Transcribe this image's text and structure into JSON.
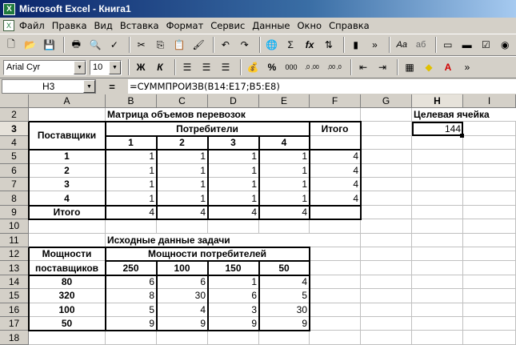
{
  "window": {
    "title": "Microsoft Excel - Книга1",
    "logo": "X"
  },
  "menu": [
    "Файл",
    "Правка",
    "Вид",
    "Вставка",
    "Формат",
    "Сервис",
    "Данные",
    "Окно",
    "Справка"
  ],
  "toolbar": {
    "font": "Arial Cyr",
    "size": "10",
    "bold": "Ж",
    "italic": "К",
    "percent": "%",
    "thousands": "000",
    "inc_dec": ",0 ,00",
    "dec_dec": ",00 ,0",
    "sigma": "Σ",
    "fx": "fx",
    "aa": "Аа",
    "ab": "аб"
  },
  "formula_bar": {
    "cell_ref": "H3",
    "equals": "=",
    "formula": "=СУММПРОИЗВ(B14:E17;B5:E8)"
  },
  "columns": [
    "A",
    "B",
    "C",
    "D",
    "E",
    "F",
    "G",
    "H",
    "I"
  ],
  "rows": [
    "2",
    "3",
    "4",
    "5",
    "6",
    "7",
    "8",
    "9",
    "10",
    "11",
    "12",
    "13",
    "14",
    "15",
    "16",
    "17",
    "18"
  ],
  "active": {
    "col": "H",
    "row": "3"
  },
  "sheet": {
    "matrix_title": "Матрица объемов перевозок",
    "suppliers": "Поставщики",
    "consumers": "Потребители",
    "total": "Итого",
    "target_label": "Целевая ячейка",
    "target_value": "144",
    "consumer_nums": [
      "1",
      "2",
      "3",
      "4"
    ],
    "supplier_nums": [
      "1",
      "2",
      "3",
      "4"
    ],
    "matrix": [
      [
        "1",
        "1",
        "1",
        "1"
      ],
      [
        "1",
        "1",
        "1",
        "1"
      ],
      [
        "1",
        "1",
        "1",
        "1"
      ],
      [
        "1",
        "1",
        "1",
        "1"
      ]
    ],
    "row_totals": [
      "4",
      "4",
      "4",
      "4"
    ],
    "total_label": "Итого",
    "col_totals": [
      "4",
      "4",
      "4",
      "4"
    ],
    "source_title": "Исходные данные задачи",
    "supplier_power_1": "Мощности",
    "supplier_power_2": "поставщиков",
    "consumer_power": "Мощности потребителей",
    "consumer_caps": [
      "250",
      "100",
      "150",
      "50"
    ],
    "supplier_caps": [
      "80",
      "320",
      "100",
      "50"
    ],
    "costs": [
      [
        "6",
        "6",
        "1",
        "4"
      ],
      [
        "8",
        "30",
        "6",
        "5"
      ],
      [
        "5",
        "4",
        "3",
        "30"
      ],
      [
        "9",
        "9",
        "9",
        "9"
      ]
    ]
  }
}
